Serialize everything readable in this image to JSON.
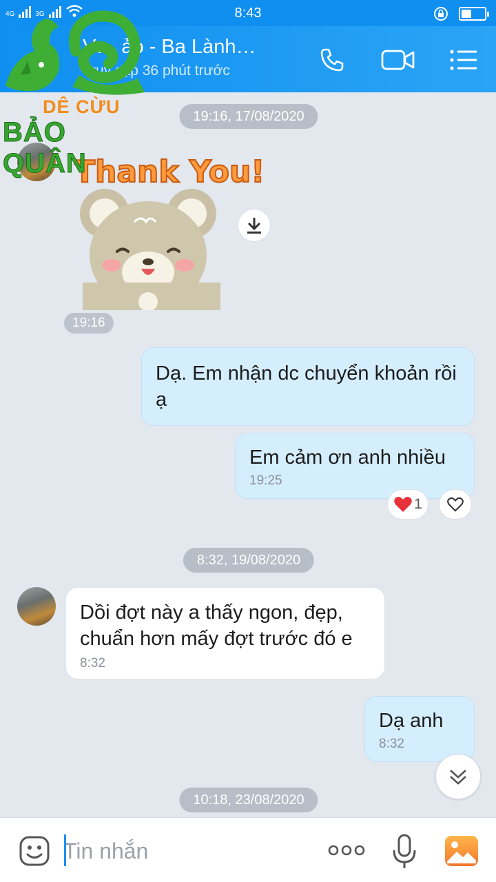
{
  "status_bar": {
    "network_1": "4G",
    "network_2": "3G",
    "time": "8:43",
    "battery_level": 0.45
  },
  "header": {
    "title": "V… ảo - Ba Lành…",
    "subtitle": "Truy cập 36 phút trước",
    "icons": [
      "phone-icon",
      "video-call-icon",
      "menu-icon"
    ]
  },
  "logo": {
    "line1": "DÊ CỪU",
    "line2": "BẢO QUÂN"
  },
  "chat": {
    "date_1": "19:16, 17/08/2020",
    "sticker_text": "Thank You!",
    "sticker_time": "19:16",
    "msg_1": "Dạ.  Em nhận dc chuyển khoản rồi ạ",
    "msg_2": "Em cảm ơn anh nhiều",
    "msg_2_time": "19:25",
    "reaction_count": "1",
    "date_2": "8:32, 19/08/2020",
    "msg_3": "Dồi đợt này a thấy ngon, đẹp, chuẩn hơn mấy đợt trước đó e",
    "msg_3_time": "8:32",
    "msg_4": "Dạ anh",
    "msg_4_time": "8:32",
    "date_3": "10:18, 23/08/2020"
  },
  "input_bar": {
    "placeholder": "Tin nhắn",
    "icons": [
      "emoji-icon",
      "more-icon",
      "microphone-icon",
      "image-icon"
    ]
  },
  "colors": {
    "header": "#0f8ff0",
    "my_bubble": "#d5eefd",
    "background": "#e3e8ef",
    "heart": "#e8323a"
  }
}
